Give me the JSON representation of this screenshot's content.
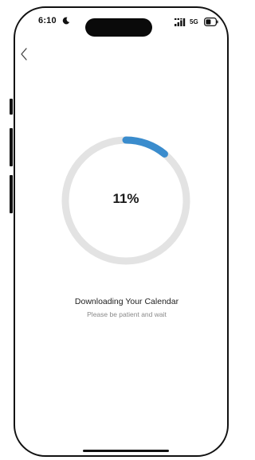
{
  "status_bar": {
    "time": "6:10",
    "network": "5G",
    "moon_icon": "moon-icon",
    "signal_icon": "signal-icon",
    "battery_icon": "battery-icon"
  },
  "navigation": {
    "back_icon": "chevron-left-icon"
  },
  "progress": {
    "value": 0.11,
    "label": "11%",
    "track_color": "#e3e3e3",
    "fill_color": "#3a8ccd"
  },
  "content": {
    "title": "Downloading Your Calendar",
    "subtitle": "Please be patient and wait"
  }
}
